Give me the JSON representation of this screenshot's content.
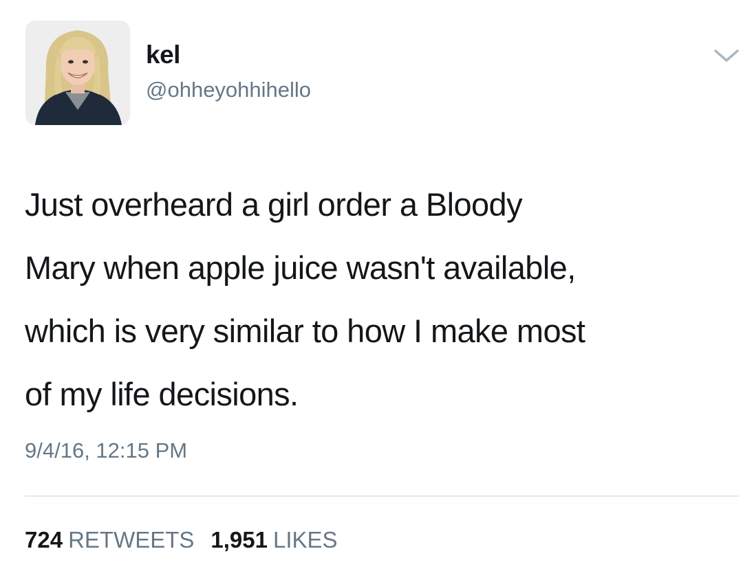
{
  "user": {
    "display_name": "kel",
    "handle": "@ohheyohhihello",
    "avatar_icon": "profile-photo"
  },
  "tweet": {
    "text_lines": [
      "Just overheard a girl order a Bloody",
      "Mary when apple juice wasn't available,",
      "which is very similar to how I make most",
      "of my life decisions."
    ],
    "timestamp": "9/4/16, 12:15 PM"
  },
  "stats": {
    "retweets_count": "724",
    "retweets_label": "RETWEETS",
    "likes_count": "1,951",
    "likes_label": "LIKES"
  },
  "icons": {
    "menu": "chevron-down-icon"
  },
  "colors": {
    "text": "#14171a",
    "secondary": "#657786",
    "divider": "#e1e8ed"
  }
}
